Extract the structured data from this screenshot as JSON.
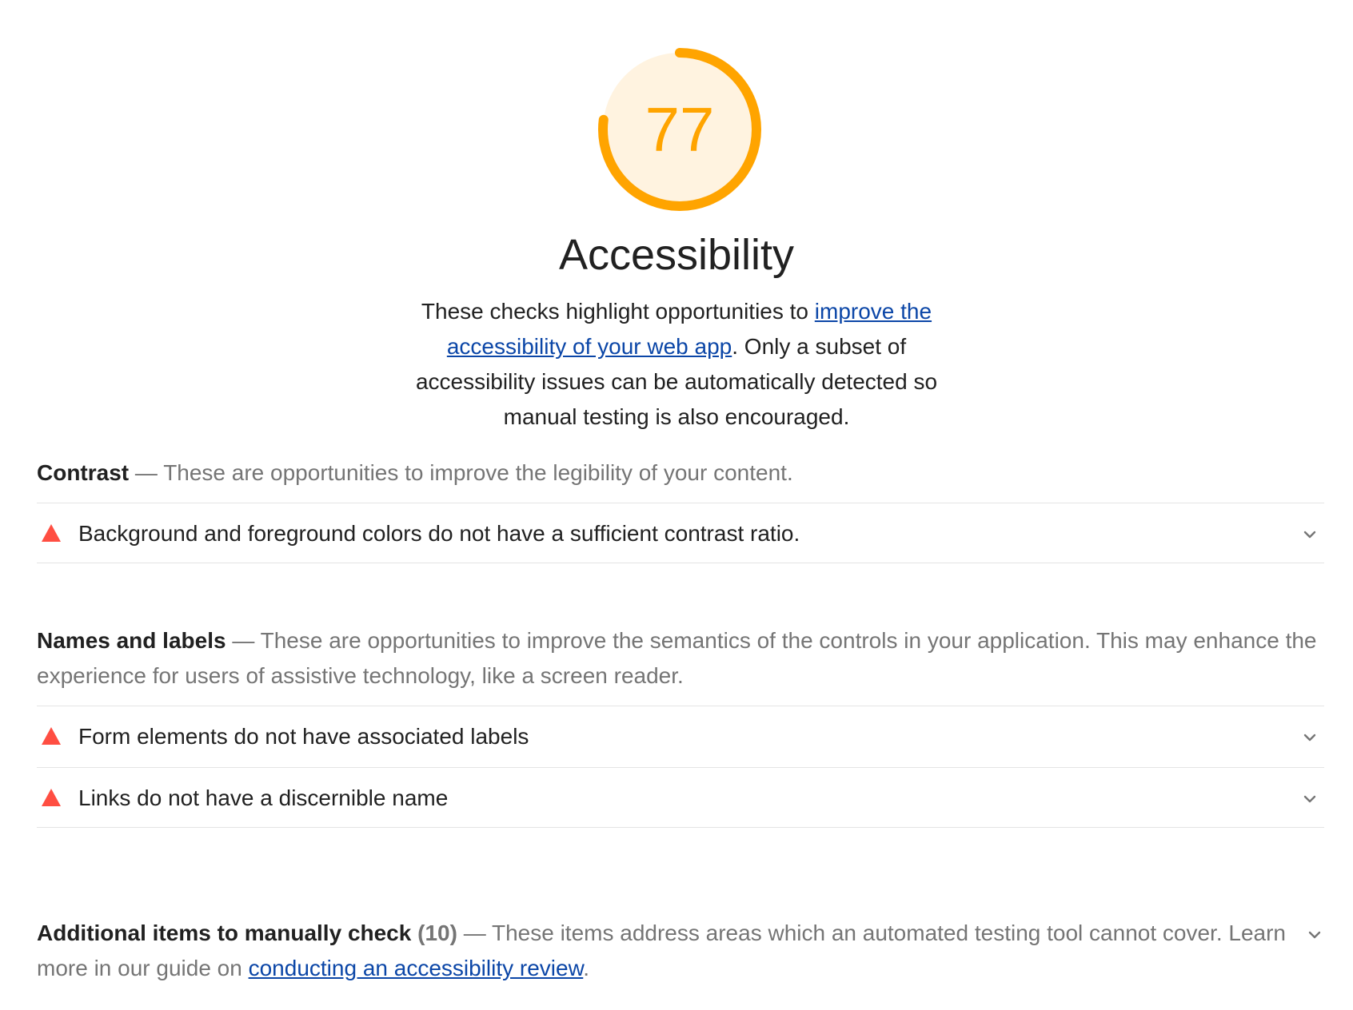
{
  "score": {
    "value": "77",
    "fraction": 0.77,
    "color": "#ffa400",
    "fill_color": "#fff3e0",
    "icon": "score-gauge"
  },
  "category": {
    "title": "Accessibility",
    "description_prefix": "These checks highlight opportunities to ",
    "description_link": "improve the accessibility of your web app",
    "description_suffix": ". Only a subset of accessibility issues can be automatically detected so manual testing is also encouraged."
  },
  "groups": [
    {
      "title": "Contrast",
      "separator": " — ",
      "description": "These are opportunities to improve the legibility of your content.",
      "audits": [
        {
          "title": "Background and foreground colors do not have a sufficient contrast ratio.",
          "status_icon": "fail-triangle-icon",
          "toggle_icon": "chevron-down-icon"
        }
      ]
    },
    {
      "title": "Names and labels",
      "separator": " — ",
      "description": "These are opportunities to improve the semantics of the controls in your application. This may enhance the experience for users of assistive technology, like a screen reader.",
      "audits": [
        {
          "title": "Form elements do not have associated labels",
          "status_icon": "fail-triangle-icon",
          "toggle_icon": "chevron-down-icon"
        },
        {
          "title": "Links do not have a discernible name",
          "status_icon": "fail-triangle-icon",
          "toggle_icon": "chevron-down-icon"
        }
      ]
    }
  ],
  "manual": {
    "title": "Additional items to manually check",
    "count": "(10)",
    "separator": " — ",
    "description_prefix": "These items address areas which an automated testing tool cannot cover. Learn more in our guide on ",
    "description_link": "conducting an accessibility review",
    "description_suffix": ".",
    "toggle_icon": "chevron-down-icon"
  },
  "colors": {
    "fail": "#ff4e42",
    "link": "#0b46a7",
    "muted_text": "#757575",
    "divider": "#e4e4e4"
  }
}
